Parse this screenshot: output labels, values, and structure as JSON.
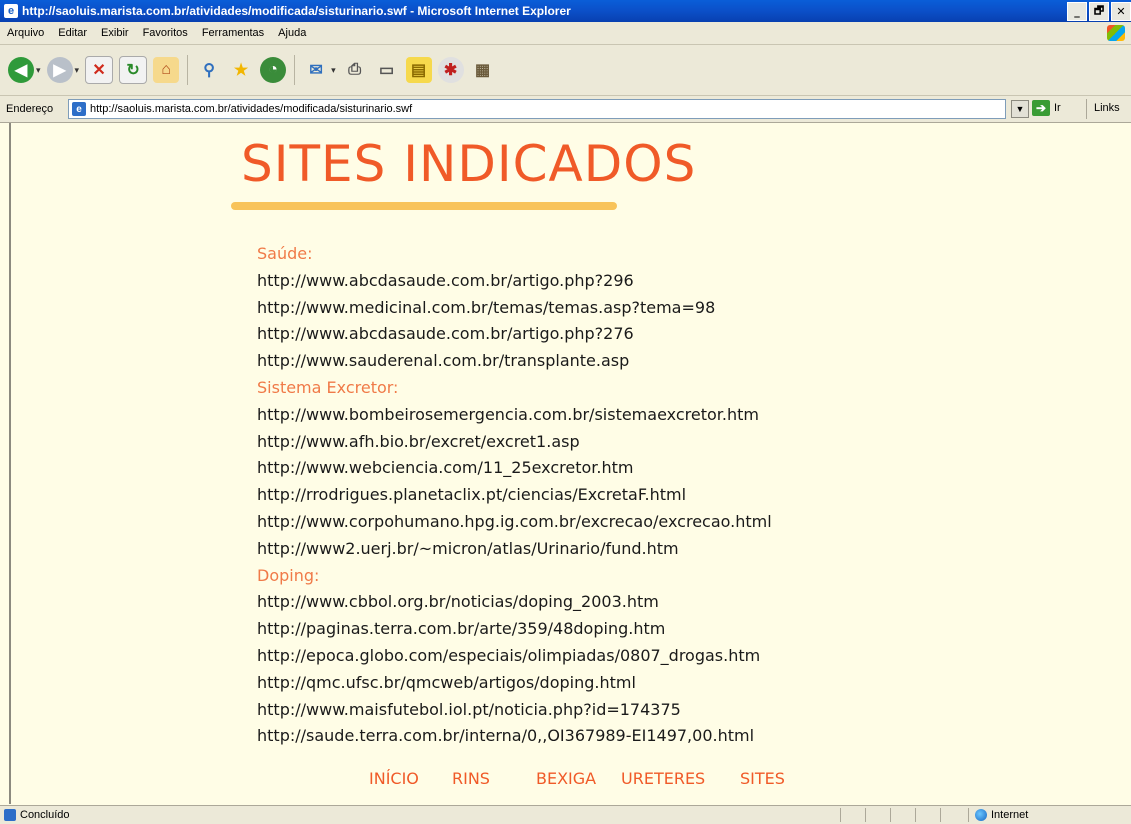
{
  "window": {
    "title": "http://saoluis.marista.com.br/atividades/modificada/sisturinario.swf - Microsoft Internet Explorer",
    "controls": [
      "_",
      "🗗",
      "✕"
    ]
  },
  "menu": [
    "Arquivo",
    "Editar",
    "Exibir",
    "Favoritos",
    "Ferramentas",
    "Ajuda"
  ],
  "address": {
    "label": "Endereço",
    "url": "http://saoluis.marista.com.br/atividades/modificada/sisturinario.swf",
    "go_label": "Ir",
    "links_label": "Links"
  },
  "page": {
    "title": "SITES INDICADOS",
    "sections": [
      {
        "heading": "Saúde:",
        "links": [
          "http://www.abcdasaude.com.br/artigo.php?296",
          "http://www.medicinal.com.br/temas/temas.asp?tema=98",
          "http://www.abcdasaude.com.br/artigo.php?276",
          "http://www.sauderenal.com.br/transplante.asp"
        ]
      },
      {
        "heading": "Sistema Excretor:",
        "links": [
          "http://www.bombeirosemergencia.com.br/sistemaexcretor.htm",
          "http://www.afh.bio.br/excret/excret1.asp",
          "http://www.webciencia.com/11_25excretor.htm",
          "http://rrodrigues.planetaclix.pt/ciencias/ExcretaF.html",
          "http://www.corpohumano.hpg.ig.com.br/excrecao/excrecao.html",
          "http://www2.uerj.br/~micron/atlas/Urinario/fund.htm"
        ]
      },
      {
        "heading": "Doping:",
        "links": [
          "http://www.cbbol.org.br/noticias/doping_2003.htm",
          "http://paginas.terra.com.br/arte/359/48doping.htm",
          "http://epoca.globo.com/especiais/olimpiadas/0807_drogas.htm",
          "http://qmc.ufsc.br/qmcweb/artigos/doping.html",
          "http://www.maisfutebol.iol.pt/noticia.php?id=174375",
          "http://saude.terra.com.br/interna/0,,OI367989-EI1497,00.html"
        ]
      }
    ],
    "nav": [
      "INÍCIO",
      "RINS",
      "BEXIGA",
      "URETERES",
      "SITES"
    ]
  },
  "status": {
    "text": "Concluído",
    "zone": "Internet"
  }
}
